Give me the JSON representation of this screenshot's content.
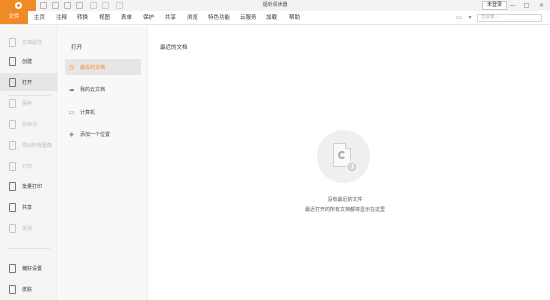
{
  "titlebar": {
    "window_title": "福昕阅读器",
    "login_label": "未登录",
    "controls": {
      "minimize": "—",
      "maximize": "□",
      "close": "×"
    }
  },
  "menubar": {
    "items": [
      "文件",
      "主页",
      "注释",
      "转换",
      "视图",
      "表单",
      "保护",
      "共享",
      "浏览",
      "特色功能",
      "云服务",
      "加载",
      "帮助"
    ],
    "search_placeholder": "告诉我..."
  },
  "sidebar": {
    "items": [
      {
        "label": "文档属性",
        "icon": "document-properties-icon",
        "enabled": false
      },
      {
        "label": "创建",
        "icon": "create-icon",
        "enabled": true
      },
      {
        "label": "打开",
        "icon": "open-icon",
        "enabled": true,
        "active": true
      },
      {
        "label": "保存",
        "icon": "save-icon",
        "enabled": false
      },
      {
        "label": "另存为",
        "icon": "save-as-icon",
        "enabled": false
      },
      {
        "label": "导出所有图像",
        "icon": "export-images-icon",
        "enabled": false
      },
      {
        "label": "打印",
        "icon": "print-icon",
        "enabled": false
      },
      {
        "label": "批量打印",
        "icon": "batch-print-icon",
        "enabled": true
      },
      {
        "label": "共享",
        "icon": "share-icon",
        "enabled": true
      },
      {
        "label": "关闭",
        "icon": "close-document-icon",
        "enabled": false
      },
      {
        "label": "偏好设置",
        "icon": "preferences-icon",
        "enabled": true
      },
      {
        "label": "皮肤",
        "icon": "skin-icon",
        "enabled": true
      }
    ]
  },
  "subpanel": {
    "title": "打开",
    "items": [
      {
        "label": "最近的文档",
        "icon": "clock-icon",
        "active": true
      },
      {
        "label": "我的云文档",
        "icon": "cloud-icon"
      },
      {
        "label": "计算机",
        "icon": "computer-icon"
      },
      {
        "label": "添加一个位置",
        "icon": "add-location-icon"
      }
    ]
  },
  "main": {
    "title": "最近的文档",
    "empty_state": {
      "line1": "没有最近的文件",
      "line2": "最近打开的所有文档都将显示在这里"
    }
  },
  "colors": {
    "accent": "#f08a24"
  }
}
